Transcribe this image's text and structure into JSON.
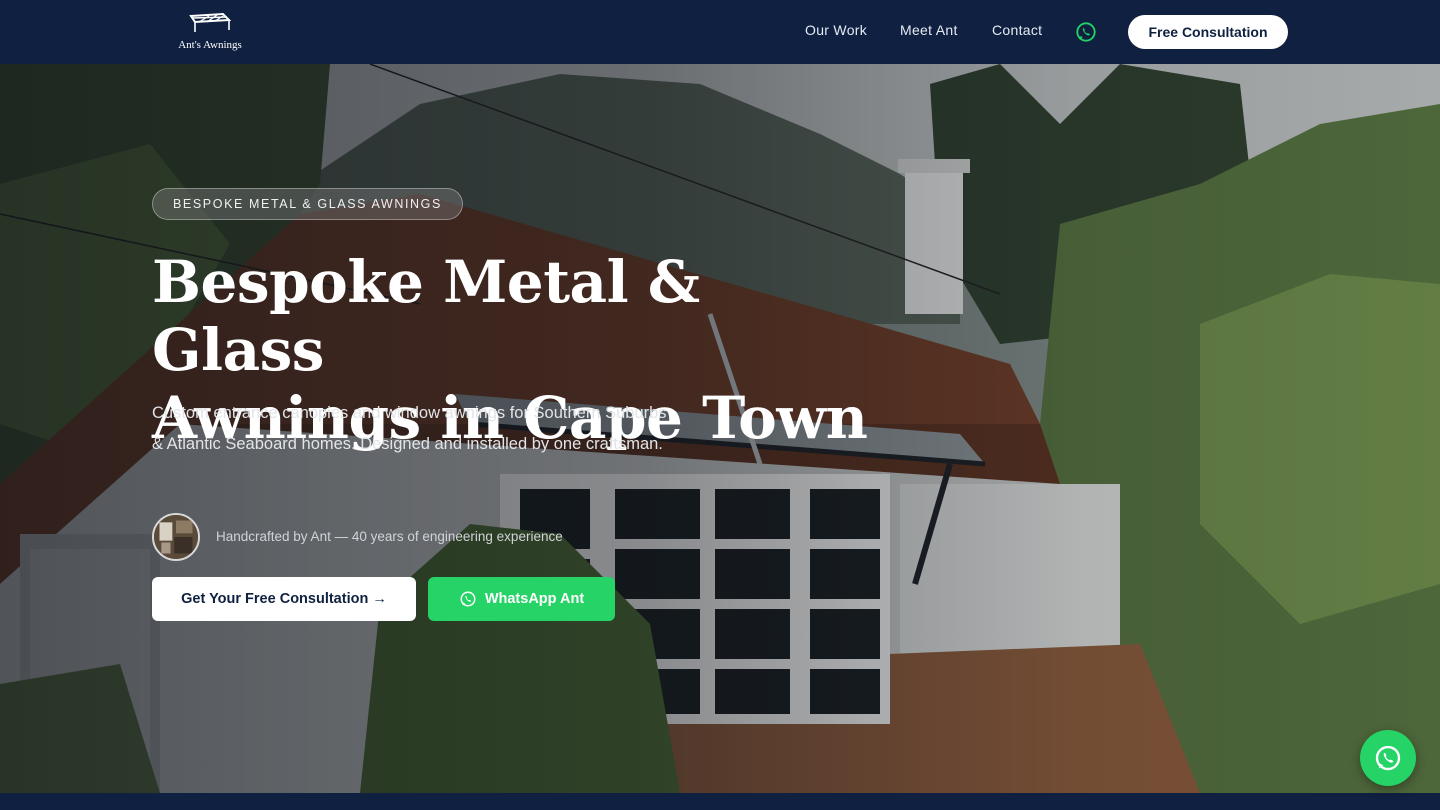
{
  "brand": {
    "name": "Ant's Awnings"
  },
  "nav": {
    "links": [
      "Our Work",
      "Meet Ant",
      "Contact"
    ],
    "cta": "Free Consultation"
  },
  "hero": {
    "badge": "BESPOKE METAL & GLASS AWNINGS",
    "headline_line1": "Bespoke Metal & Glass",
    "headline_line2": "Awnings in Cape Town",
    "subtitle": "Custom entrance canopies and window awnings for Southern Suburbs & Atlantic Seaboard homes. Designed and installed by one craftsman.",
    "craftsman": "Handcrafted by Ant — 40 years of engineering experience",
    "primary_cta": "Get Your Free Consultation →",
    "whatsapp_cta": "WhatsApp Ant"
  },
  "icons": {
    "logo": "awning-logo-icon",
    "whatsapp": "whatsapp-icon"
  },
  "colors": {
    "navy": "#0f2040",
    "whatsapp_green": "#25d366",
    "white": "#ffffff"
  }
}
